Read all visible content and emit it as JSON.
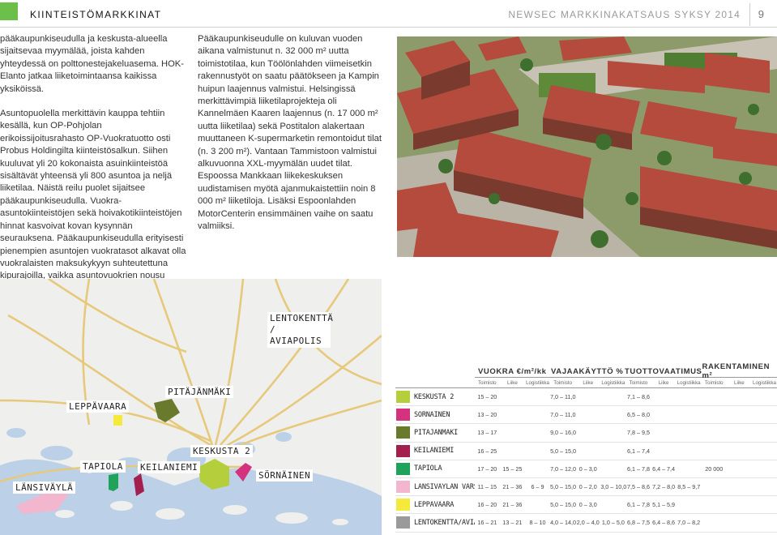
{
  "header": {
    "section_title": "KIINTEISTÖMARKKINAT",
    "publication_title": "NEWSEC MARKKINAKATSAUS SYKSY 2014",
    "page_number": "9"
  },
  "column1": [
    "pääkaupunkiseudulla ja keskusta-alueella sijaitsevaa myymälää, joista kahden yhteydessä on polttonestejakeluasema. HOK-Elanto jatkaa liiketoimintaansa kaikissa yksiköissä.",
    "Asuntopuolella merkittävin kauppa tehtiin kesällä, kun OP-Pohjolan erikoissijoitusrahasto OP-Vuokratuotto osti Probus Holdingilta kiinteistösalkun. Siihen kuuluvat yli 20 kokonaista asuinkiinteistöä sisältävät yhteensä yli 800 asuntoa ja neljä liiketilaa. Näistä reilu puolet sijaitsee pääkaupunkiseudulla. Vuokra­asuntokiinteistöjen sekä hoivakotikiinteistöjen hinnat kasvoivat kovan kysynnän seurauksena. Pääkaupunkiseudulla erityisesti pienempien asuntojen vuokratasot alkavat olla vuokralaisten maksukykyyn suhteutettuna kipurajoilla, vaikka asuntovuokrien nousu onkin tasoittunut."
  ],
  "column2": "Pääkaupunkiseudulle on kuluvan vuoden aikana valmistunut n. 32 000 m² uutta toimistotilaa, kun Töölönlahden viimeisetkin rakennustyöt on saatu päätökseen ja Kampin huipun laajennus valmistui. Helsingissä merkittävimpiä liiketilaprojekteja oli Kannelmäen Kaaren laajennus (n. 17 000 m² uutta liiketilaa) sekä Postitalon alakertaan muuttaneen K-supermarketin remontoidut tilat (n. 3 200 m²). Vantaan Tammistoon valmistui alkuvuonna XXL-myymälän uudet tilat. Espoossa Mankkaan liikekeskuksen uudistamisen myötä ajanmukaistettiin noin 8 000 m² liiketiloja. Lisäksi Espoonlahden MotorCenterin ensimmäinen vaihe on saatu valmiiksi.",
  "map_labels": {
    "lentokentta": "LENTOKENTTÄ / AVIAPOLIS",
    "pitajanmaki": "PITÄJÄNMÄKI",
    "leppavaara": "LEPPÄVAARA",
    "keskusta2": "KESKUSTA 2",
    "tapiola": "TAPIOLA",
    "keilaniemi": "KEILANIEMI",
    "sornainen": "SÖRNÄINEN",
    "lansivayla": "LÄNSIVÄYLÄ"
  },
  "table": {
    "group_headers": [
      "VUOKRA €/m²/kk",
      "VAJAAKÄYTTÖ %",
      "TUOTTOVAATIMUS",
      "RAKENTAMINEN m²"
    ],
    "sub_headers": [
      "Toimisto",
      "Liike",
      "Logistiikka"
    ],
    "rows": [
      {
        "name": "KESKUSTA 2",
        "color": "#b4cf3b",
        "cells": [
          "15 – 20",
          "",
          "",
          "7,0 – 11,0",
          "",
          "",
          "7,1 – 8,6",
          "",
          "",
          "",
          "",
          ""
        ]
      },
      {
        "name": "SÖRNÄINEN",
        "color": "#d4317e",
        "cells": [
          "13 – 20",
          "",
          "",
          "7,0 – 11,0",
          "",
          "",
          "6,5 – 8,0",
          "",
          "",
          "",
          "",
          ""
        ]
      },
      {
        "name": "PITÄJÄNMÄKI",
        "color": "#6a7a2c",
        "cells": [
          "13 – 17",
          "",
          "",
          "9,0 – 16,0",
          "",
          "",
          "7,8 – 9,5",
          "",
          "",
          "",
          "",
          ""
        ]
      },
      {
        "name": "KEILANIEMI",
        "color": "#a31f4e",
        "cells": [
          "16 – 25",
          "",
          "",
          "5,0 – 15,0",
          "",
          "",
          "6,1 – 7,4",
          "",
          "",
          "",
          "",
          ""
        ]
      },
      {
        "name": "TAPIOLA",
        "color": "#1fa35a",
        "cells": [
          "17 – 20",
          "15 – 25",
          "",
          "7,0 – 12,0",
          "0 – 3,0",
          "",
          "6,1 – 7,8",
          "6,4 – 7,4",
          "",
          "20 000",
          "",
          ""
        ]
      },
      {
        "name": "LÄNSIVÄYLÄN VARSI",
        "color": "#f2b6cf",
        "cells": [
          "11 – 15",
          "21 – 36",
          "6 – 9",
          "5,0 – 15,0",
          "0 – 2,0",
          "3,0 – 10,0",
          "7,5 – 8,6",
          "7,2 – 8,0",
          "8,5 – 9,7",
          "",
          "",
          ""
        ]
      },
      {
        "name": "LEPPÄVAARA",
        "color": "#f5ea3b",
        "cells": [
          "16 – 20",
          "21 – 36",
          "",
          "5,0 – 15,0",
          "0 – 3,0",
          "",
          "6,1 – 7,8",
          "5,1 – 5,9",
          "",
          "",
          "",
          ""
        ]
      },
      {
        "name": "LENTOKENTTÄ/AVIAPOLIS",
        "color": "#9a9a9a",
        "cells": [
          "16 – 21",
          "13 – 21",
          "8 – 10",
          "4,0 – 14,0",
          "2,0 – 4,0",
          "1,0 – 5,0",
          "6,8 – 7,5",
          "6,4 – 8,6",
          "7,0 – 8,2",
          "",
          "",
          ""
        ]
      }
    ]
  }
}
